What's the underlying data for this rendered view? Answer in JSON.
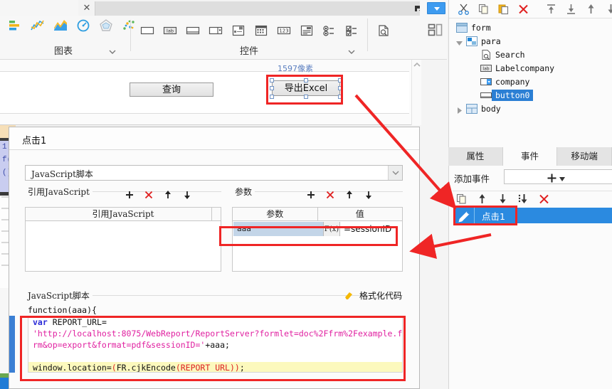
{
  "window": {
    "tab_close": "✕"
  },
  "ribbon": {
    "groups": [
      {
        "label": "图表",
        "icons": [
          "bar-chart-icon",
          "line-chart-icon",
          "area-chart-icon",
          "gauge-chart-icon",
          "radar-chart-icon",
          "scatter-chart-icon"
        ]
      },
      {
        "label": "控件",
        "icons": [
          "textbox-icon",
          "label-icon",
          "textarea-icon",
          "combobox-icon",
          "treeview-icon",
          "datepicker-icon",
          "numberbox-icon",
          "editor-icon",
          "radio-group-icon",
          "checkbox-group-icon",
          "report-preview-icon"
        ]
      }
    ]
  },
  "canvas": {
    "pixel_label": "1597像素",
    "query_button": "查询",
    "export_button": "导出Excel"
  },
  "dialog": {
    "title": "点击1",
    "script_type": "JavaScript脚本",
    "left_group_legend": "引用JavaScript",
    "right_group_legend": "参数",
    "left_table_header": "引用JavaScript",
    "param_columns": [
      "参数",
      "值"
    ],
    "param_rows": [
      {
        "name": "aaa",
        "fx": "F(x)",
        "value": "=sessionID"
      }
    ],
    "script_legend": "JavaScript脚本",
    "format_code_link": "格式化代码",
    "function_signature": "function(aaa){",
    "code_lines": [
      {
        "segments": [
          {
            "t": "var ",
            "c": "kw"
          },
          {
            "t": "REPORT_URL=",
            "c": "plain"
          }
        ],
        "hl": false
      },
      {
        "segments": [
          {
            "t": "'http://localhost:8075/WebReport/ReportServer?formlet=doc%2Ffrm%2Fexample.f",
            "c": "str"
          }
        ],
        "hl": false
      },
      {
        "segments": [
          {
            "t": "rm&op=export&format=pdf&sessionID='",
            "c": "str"
          },
          {
            "t": "+aaa;",
            "c": "plain"
          }
        ],
        "hl": false
      },
      {
        "segments": [
          {
            "t": " ",
            "c": "plain"
          }
        ],
        "hl": false
      },
      {
        "segments": [
          {
            "t": "window.location=",
            "c": "plain"
          },
          {
            "t": "(",
            "c": "paren"
          },
          {
            "t": "FR.cjkEncode",
            "c": "plain"
          },
          {
            "t": "(REPORT_URL)",
            "c": "paren"
          },
          {
            "t": ")",
            "c": "paren"
          },
          {
            "t": ";",
            "c": "plain"
          }
        ],
        "hl": true
      }
    ],
    "toolbar_icons": [
      "add-icon",
      "delete-icon",
      "move-up-icon",
      "move-down-icon"
    ]
  },
  "right_panel": {
    "toolbar_icons": [
      "cut-icon",
      "copy-icon",
      "paste-icon",
      "delete-icon",
      "move-top-icon",
      "move-bottom-icon",
      "move-up-icon",
      "move-down-icon"
    ],
    "tree": [
      {
        "label": "form",
        "depth": 0,
        "icon": "form-icon",
        "expander": "",
        "selected": false
      },
      {
        "label": "para",
        "depth": 1,
        "icon": "para-icon",
        "expander": "open",
        "selected": false
      },
      {
        "label": "Search",
        "depth": 2,
        "icon": "search-icon",
        "expander": "",
        "selected": false
      },
      {
        "label": "Labelcompany",
        "depth": 2,
        "icon": "label-icon",
        "expander": "",
        "selected": false
      },
      {
        "label": "company",
        "depth": 2,
        "icon": "combobox-icon",
        "expander": "",
        "selected": false
      },
      {
        "label": "button0",
        "depth": 2,
        "icon": "button-icon",
        "expander": "",
        "selected": true
      },
      {
        "label": "body",
        "depth": 1,
        "icon": "body-icon",
        "expander": "closed",
        "selected": false
      }
    ],
    "tabs": [
      {
        "label": "属性",
        "active": false
      },
      {
        "label": "事件",
        "active": true
      },
      {
        "label": "移动端",
        "active": false
      }
    ],
    "add_event_label": "添加事件",
    "event_toolbar_icons": [
      "copy-icon",
      "move-up-icon",
      "move-down-icon",
      "move-to-bottom-icon",
      "delete-icon"
    ],
    "events": [
      {
        "label": "点击1",
        "icon": "pencil-icon",
        "selected": true
      }
    ]
  },
  "annotations": {
    "highlight_color": "#ef2525",
    "boxes": [
      "export-button-highlight",
      "param-row-highlight",
      "code-block-highlight",
      "event-row-highlight"
    ],
    "arrows": [
      "button-to-event-arrow",
      "event-to-param-arrow"
    ]
  }
}
